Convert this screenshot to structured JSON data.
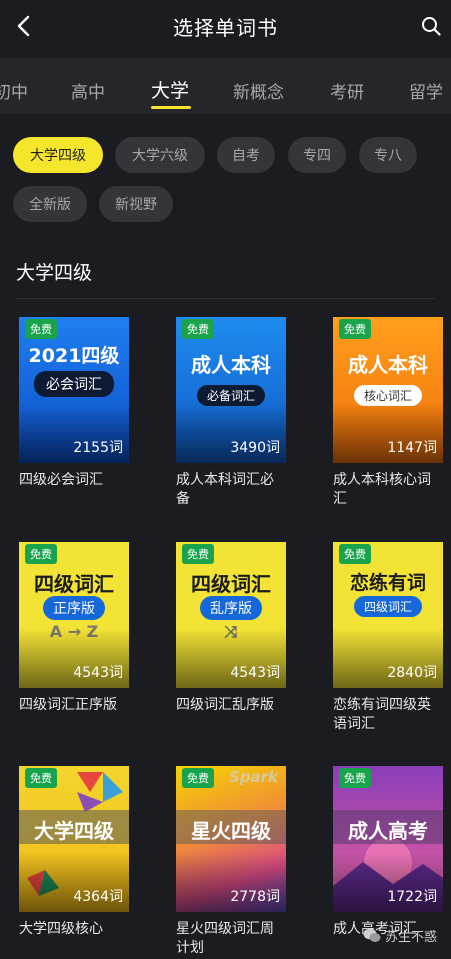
{
  "header": {
    "title": "选择单词书"
  },
  "tabs": [
    {
      "label": "初中"
    },
    {
      "label": "高中"
    },
    {
      "label": "大学"
    },
    {
      "label": "新概念"
    },
    {
      "label": "考研"
    },
    {
      "label": "留学"
    }
  ],
  "chips": [
    {
      "label": "大学四级"
    },
    {
      "label": "大学六级"
    },
    {
      "label": "自考"
    },
    {
      "label": "专四"
    },
    {
      "label": "专八"
    },
    {
      "label": "全新版"
    },
    {
      "label": "新视野"
    }
  ],
  "section": {
    "title": "大学四级"
  },
  "books": [
    {
      "badge": "免费",
      "cover_line1": "2021四级",
      "cover_line2": "必会词汇",
      "count": "2155词",
      "caption": "四级必会词汇"
    },
    {
      "badge": "免费",
      "cover_line1": "成人本科",
      "cover_line2": "必备词汇",
      "count": "3490词",
      "caption": "成人本科词汇必备"
    },
    {
      "badge": "免费",
      "cover_line1": "成人本科",
      "cover_line2": "核心词汇",
      "count": "1147词",
      "caption": "成人本科核心词汇"
    },
    {
      "badge": "免费",
      "cover_line1": "四级词汇",
      "cover_line2": "正序版",
      "cover_extra": "A → Z",
      "count": "4543词",
      "caption": "四级词汇正序版"
    },
    {
      "badge": "免费",
      "cover_line1": "四级词汇",
      "cover_line2": "乱序版",
      "cover_extra": "⤨",
      "count": "4543词",
      "caption": "四级词汇乱序版"
    },
    {
      "badge": "免费",
      "cover_line1": "恋练有词",
      "cover_line2": "四级词汇",
      "count": "2840词",
      "caption": "恋练有词四级英语词汇"
    },
    {
      "badge": "免费",
      "cover_line1": "大学四级",
      "count": "4364词",
      "caption": "大学四级核心"
    },
    {
      "badge": "免费",
      "cover_brand": "Spark",
      "cover_line1": "星火四级",
      "count": "2778词",
      "caption": "星火四级词汇周计划"
    },
    {
      "badge": "免费",
      "cover_line1": "成人高考",
      "count": "1722词",
      "caption": "成人高考词汇"
    }
  ],
  "watermark": {
    "text": "苏生不惑"
  },
  "colors": {
    "accent": "#f5e62b",
    "badge": "#19a34b",
    "background": "#1b1c21"
  }
}
